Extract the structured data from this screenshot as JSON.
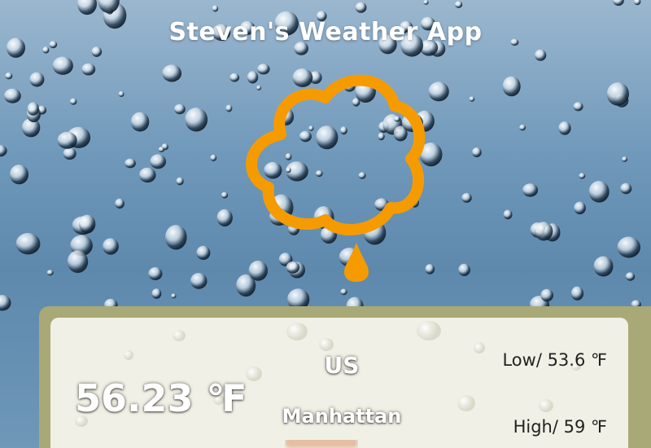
{
  "app": {
    "title": "Steven's Weather App"
  },
  "icon": {
    "name": "rain-cloud-icon",
    "color": "#f59b00"
  },
  "weather": {
    "temperature": "56.23 ℉",
    "country": "US",
    "city": "Manhattan",
    "low": "Low/ 53.6 ℉",
    "high": "High/ 59 ℉"
  },
  "colors": {
    "panel_border": "#a8a976",
    "panel_bg": "#f3f3ec"
  }
}
